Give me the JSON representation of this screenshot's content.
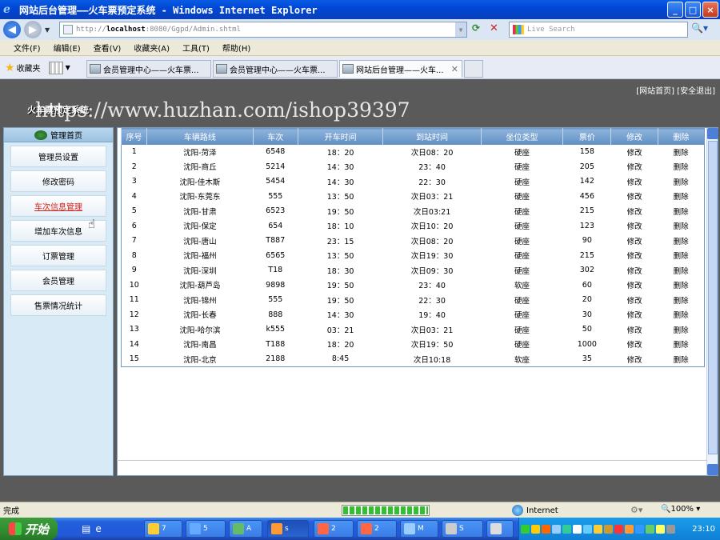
{
  "window": {
    "title": "网站后台管理——火车票预定系统 - Windows Internet Explorer",
    "controls": [
      "_",
      "□",
      "×"
    ]
  },
  "addressbar": {
    "url_prefix": "http://",
    "url_host": "localhost",
    "url_rest": ":8080/Ggpd/Admin.shtml",
    "search_placeholder": "Live Search"
  },
  "menubar": {
    "items": [
      "文件(F)",
      "编辑(E)",
      "查看(V)",
      "收藏夹(A)",
      "工具(T)",
      "帮助(H)"
    ]
  },
  "tabbar": {
    "favorites": "收藏夹",
    "tabs": [
      {
        "label": "会员管理中心——火车票..."
      },
      {
        "label": "会员管理中心——火车票..."
      },
      {
        "label": "网站后台管理——火车..."
      }
    ]
  },
  "page": {
    "top_links": "[网站首页] [安全退出]",
    "site_title": "火车票预定系统",
    "watermark": "https://www.huzhan.com/ishop39397"
  },
  "sidebar": {
    "header": "管理首页",
    "items": [
      {
        "label": "管理员设置"
      },
      {
        "label": "修改密码"
      },
      {
        "label": "车次信息管理"
      },
      {
        "label": "增加车次信息"
      },
      {
        "label": "订票管理"
      },
      {
        "label": "会员管理"
      },
      {
        "label": "售票情况统计"
      }
    ]
  },
  "table": {
    "headers": [
      "序号",
      "车辆路线",
      "车次",
      "开车时间",
      "到站时间",
      "坐位类型",
      "票价",
      "修改",
      "删除"
    ],
    "rows": [
      [
        "1",
        "沈阳-菏泽",
        "6548",
        "18：20",
        "次日08：20",
        "硬座",
        "158",
        "修改",
        "删除"
      ],
      [
        "2",
        "沈阳-商丘",
        "5214",
        "14：30",
        "23：40",
        "硬座",
        "205",
        "修改",
        "删除"
      ],
      [
        "3",
        "沈阳-佳木斯",
        "5454",
        "14：30",
        "22：30",
        "硬座",
        "142",
        "修改",
        "删除"
      ],
      [
        "4",
        "沈阳-东莞东",
        "555",
        "13：50",
        "次日03：21",
        "硬座",
        "456",
        "修改",
        "删除"
      ],
      [
        "5",
        "沈阳-甘肃",
        "6523",
        "19：50",
        "次日03:21",
        "硬座",
        "215",
        "修改",
        "删除"
      ],
      [
        "6",
        "沈阳-保定",
        "654",
        "18：10",
        "次日10：20",
        "硬座",
        "123",
        "修改",
        "删除"
      ],
      [
        "7",
        "沈阳-唐山",
        "T887",
        "23：15",
        "次日08：20",
        "硬座",
        "90",
        "修改",
        "删除"
      ],
      [
        "8",
        "沈阳-福州",
        "6565",
        "13：50",
        "次日19：30",
        "硬座",
        "215",
        "修改",
        "删除"
      ],
      [
        "9",
        "沈阳-深圳",
        "T18",
        "18：30",
        "次日09：30",
        "硬座",
        "302",
        "修改",
        "删除"
      ],
      [
        "10",
        "沈阳-葫芦岛",
        "9898",
        "19：50",
        "23：40",
        "软座",
        "60",
        "修改",
        "删除"
      ],
      [
        "11",
        "沈阳-锦州",
        "555",
        "19：50",
        "22：30",
        "硬座",
        "20",
        "修改",
        "删除"
      ],
      [
        "12",
        "沈阳-长春",
        "888",
        "14：30",
        "19：40",
        "硬座",
        "30",
        "修改",
        "删除"
      ],
      [
        "13",
        "沈阳-哈尔滨",
        "k555",
        "03：21",
        "次日03：21",
        "硬座",
        "50",
        "修改",
        "删除"
      ],
      [
        "14",
        "沈阳-南昌",
        "T188",
        "18：20",
        "次日19：50",
        "硬座",
        "1000",
        "修改",
        "删除"
      ],
      [
        "15",
        "沈阳-北京",
        "2188",
        "8:45",
        "次日10:18",
        "软座",
        "35",
        "修改",
        "删除"
      ]
    ]
  },
  "statusbar": {
    "status": "完成",
    "zone": "Internet",
    "zoom": "100%",
    "progress": 1.0
  },
  "taskbar": {
    "start": "开始",
    "buttons": [
      {
        "label": "7"
      },
      {
        "label": "5"
      },
      {
        "label": "A"
      },
      {
        "label": "s"
      },
      {
        "label": "2"
      },
      {
        "label": "2"
      },
      {
        "label": "M"
      },
      {
        "label": "S"
      }
    ],
    "clock": "23:10"
  },
  "colors": {
    "titlebar": "#0a5be4",
    "table_header": "#6f9ccd",
    "active_link": "#d2231b",
    "sidebar_bg": "#d7eaf6"
  }
}
